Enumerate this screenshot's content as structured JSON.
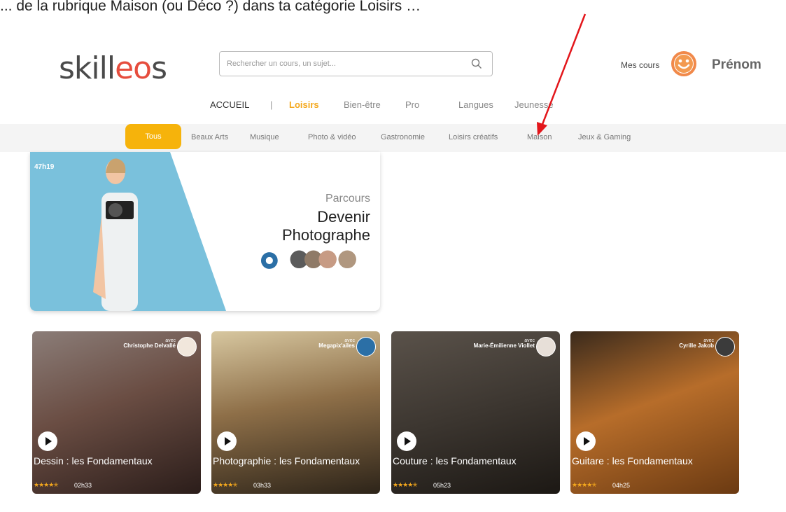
{
  "caption": "... de la rubrique Maison (ou Déco ?) dans ta catégorie Loisirs …",
  "header": {
    "logo": "skilleos",
    "search_placeholder": "Rechercher un cours, un sujet...",
    "my_courses": "Mes cours",
    "user_name": "Prénom"
  },
  "topnav": {
    "home": "ACCUEIL",
    "separator": "|",
    "items": [
      "Loisirs",
      "Bien-être",
      "Pro",
      "Langues",
      "Jeunesse"
    ],
    "active": "Loisirs"
  },
  "categories": {
    "active": "Tous",
    "items": [
      "Tous",
      "Beaux Arts",
      "Musique",
      "Photo & vidéo",
      "Gastronomie",
      "Loisirs créatifs",
      "Maison",
      "Jeux & Gaming"
    ]
  },
  "banner": {
    "duration": "47h19",
    "kicker": "Parcours",
    "title_line1": "Devenir",
    "title_line2": "Photographe"
  },
  "courses": [
    {
      "title": "Dessin : les Fondamentaux",
      "with_label": "avec",
      "teacher": "Christophe Delvallé",
      "duration": "02h33",
      "rating": 4.5
    },
    {
      "title": "Photographie : les Fondamentaux",
      "with_label": "avec",
      "teacher": "Megapix'ailes",
      "duration": "03h33",
      "rating": 4.5
    },
    {
      "title": "Couture : les Fondamentaux",
      "with_label": "avec",
      "teacher": "Marie-Émilienne Viollet",
      "duration": "05h23",
      "rating": 4.5
    },
    {
      "title": "Guitare : les Fondamentaux",
      "with_label": "avec",
      "teacher": "Cyrille Jakob",
      "duration": "04h25",
      "rating": 4.5
    }
  ],
  "colors": {
    "accent": "#f6b30b",
    "logo_accent": "#e64d3d",
    "annotation_arrow": "#e3161b"
  }
}
